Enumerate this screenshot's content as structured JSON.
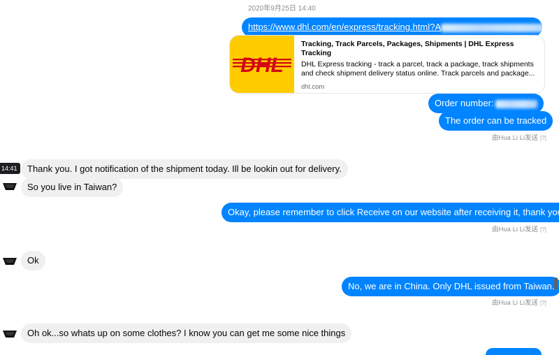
{
  "timestamp_top": "2020年9月25日 14:40",
  "link_message": "https://www.dhl.com/en/express/tracking.html?A",
  "link_card": {
    "title": "Tracking, Track Parcels, Packages, Shipments | DHL Express Tracking",
    "description": "DHL Express tracking - track a parcel, track a package, track shipments and check shipment delivery status online. Track parcels and package...",
    "domain": "dhl.com",
    "logo_text": "DHL",
    "logo_bg": "#ffcc00",
    "logo_fg": "#d40511"
  },
  "order_message": "Order number:",
  "tracked_message": "The order can be tracked",
  "sent_by_1": "由Hua Li Li发送",
  "sent_by_q": "[?]",
  "time_badge": "14:41",
  "in_msg_1": "Thank you. I got notification of the shipment today. Ill  be lookin out for delivery.",
  "in_msg_2": "So you live in Taiwan?",
  "out_msg_3": "Okay, please remember to click Receive on our website after receiving it, thank you.",
  "sent_by_2": "由Hua Li Li发送",
  "in_msg_3": "Ok",
  "out_msg_4": "No, we are in China. Only DHL issued from Taiwan.",
  "sent_by_3": "由Hua Li Li发送",
  "in_msg_4": "Oh ok...so whats up on some clothes? I know you can get me some nice things",
  "colors": {
    "outgoing": "#0084ff",
    "incoming": "#f0f0f0"
  }
}
